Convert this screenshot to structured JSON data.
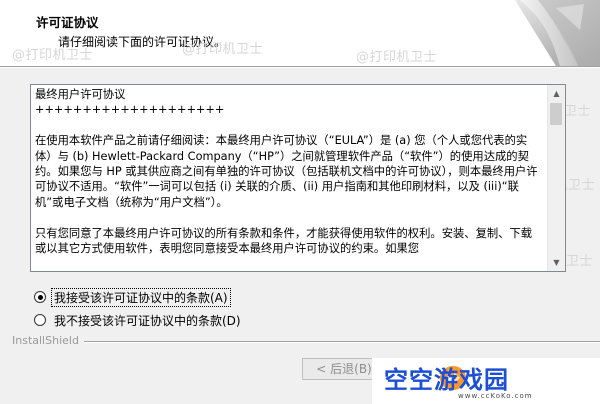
{
  "header": {
    "title": "许可证协议",
    "subtitle": "请仔细阅读下面的许可证协议。"
  },
  "watermarks": [
    "@打印机卫士",
    "@打印机卫士",
    "@打印机卫士",
    "@打印机卫士",
    "@打印机卫士",
    "@打印机卫士"
  ],
  "license": {
    "heading": "最终用户许可协议",
    "rule": "++++++++++++++++++++",
    "paragraph1": "在使用本软件产品之前请仔细阅读：本最终用户许可协议（“EULA”）是 (a) 您（个人或您代表的实体）与 (b) Hewlett-Packard Company（“HP”）之间就管理软件产品（“软件”）的使用达成的契约。如果您与 HP 或其供应商之间有单独的许可协议（包括联机文档中的许可协议），则本最终用户许可协议不适用。“软件”一词可以包括 (i) 关联的介质、(ii) 用户指南和其他印刷材料，以及 (iii)“联机”或电子文档（统称为“用户文档”）。",
    "paragraph2": "只有您同意了本最终用户许可协议的所有条款和条件，才能获得使用软件的权利。安装、复制、下载或以其它方式使用软件，表明您同意接受本最终用户许可协议的约束。如果您"
  },
  "options": {
    "accept": "我接受该许可证协议中的条款(A)",
    "decline": "我不接受该许可证协议中的条款(D)"
  },
  "footer": {
    "brand": "InstallShield",
    "back_button": "< 后退(B)"
  },
  "logo": {
    "text": "空空游戏园",
    "url": "www.ccKoKo.com"
  }
}
